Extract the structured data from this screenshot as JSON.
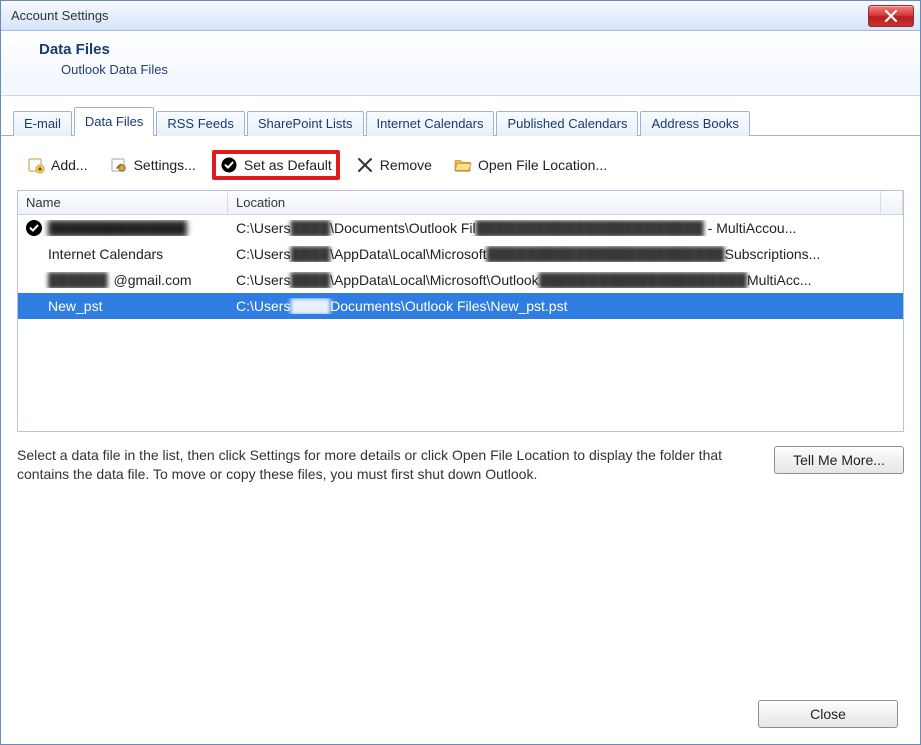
{
  "window": {
    "title": "Account Settings"
  },
  "header": {
    "title": "Data Files",
    "subtitle": "Outlook Data Files"
  },
  "tabs": [
    {
      "label": "E-mail"
    },
    {
      "label": "Data Files"
    },
    {
      "label": "RSS Feeds"
    },
    {
      "label": "SharePoint Lists"
    },
    {
      "label": "Internet Calendars"
    },
    {
      "label": "Published Calendars"
    },
    {
      "label": "Address Books"
    }
  ],
  "active_tab_index": 1,
  "toolbar": {
    "add": "Add...",
    "settings": "Settings...",
    "set_default": "Set as Default",
    "remove": "Remove",
    "open_loc": "Open File Location..."
  },
  "columns": {
    "name": "Name",
    "location": "Location"
  },
  "rows": [
    {
      "default": true,
      "name_visible": "",
      "name_blurred": "██████████████",
      "loc_prefix": "C:\\Users",
      "loc_blur": "████",
      "loc_mid": "\\Documents\\Outlook Fil",
      "loc_blur2": "███████████████████████",
      "loc_suffix": " - MultiAccou..."
    },
    {
      "default": false,
      "name_visible": "Internet Calendars",
      "name_blurred": "",
      "loc_prefix": "C:\\Users",
      "loc_blur": "████",
      "loc_mid": "\\AppData\\Local\\Microsoft",
      "loc_blur2": "████████████████████████",
      "loc_suffix": "Subscriptions..."
    },
    {
      "default": false,
      "name_visible": "@gmail.com",
      "name_blurred": "██████",
      "loc_prefix": "C:\\Users",
      "loc_blur": "████",
      "loc_mid": "\\AppData\\Local\\Microsoft\\Outlook",
      "loc_blur2": "█████████████████████",
      "loc_suffix": "MultiAcc..."
    },
    {
      "default": false,
      "selected": true,
      "name_visible": "New_pst",
      "name_blurred": "",
      "loc_prefix": "C:\\Users",
      "loc_blur": "████",
      "loc_mid": "Documents\\Outlook Files\\New_pst.pst",
      "loc_blur2": "",
      "loc_suffix": ""
    }
  ],
  "hint": "Select a data file in the list, then click Settings for more details or click Open File Location to display the folder that contains the data file. To move or copy these files, you must first shut down Outlook.",
  "buttons": {
    "tell_me_more": "Tell Me More...",
    "close": "Close"
  }
}
